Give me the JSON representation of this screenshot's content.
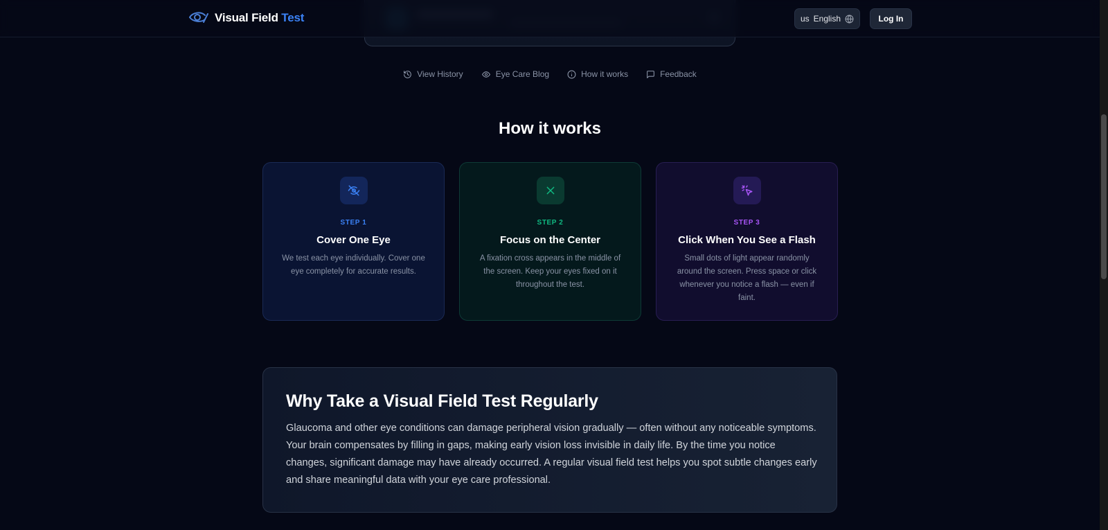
{
  "header": {
    "brand_main": "Visual Field",
    "brand_accent": "Test",
    "language_code": "us",
    "language_label": "English",
    "login_label": "Log In"
  },
  "subnav": {
    "items": [
      {
        "label": "View History",
        "icon": "history-icon"
      },
      {
        "label": "Eye Care Blog",
        "icon": "eye-icon"
      },
      {
        "label": "How it works",
        "icon": "info-icon"
      },
      {
        "label": "Feedback",
        "icon": "chat-icon"
      }
    ]
  },
  "how_it_works": {
    "title": "How it works",
    "steps": [
      {
        "label": "STEP 1",
        "title": "Cover One Eye",
        "desc": "We test each eye individually. Cover one eye completely for accurate results.",
        "icon": "eye-off-icon",
        "color": "#3b82f6"
      },
      {
        "label": "STEP 2",
        "title": "Focus on the Center",
        "desc": "A fixation cross appears in the middle of the screen. Keep your eyes fixed on it throughout the test.",
        "icon": "cross-icon",
        "color": "#10b981"
      },
      {
        "label": "STEP 3",
        "title": "Click When You See a Flash",
        "desc": "Small dots of light appear randomly around the screen. Press space or click whenever you notice a flash — even if faint.",
        "icon": "pointer-click-icon",
        "color": "#a855f7"
      }
    ]
  },
  "why": {
    "title": "Why Take a Visual Field Test Regularly",
    "text": "Glaucoma and other eye conditions can damage peripheral vision gradually — often without any noticeable symptoms. Your brain compensates by filling in gaps, making early vision loss invisible in daily life. By the time you notice changes, significant damage may have already occurred. A regular visual field test helps you spot subtle changes early and share meaningful data with your eye care professional."
  }
}
